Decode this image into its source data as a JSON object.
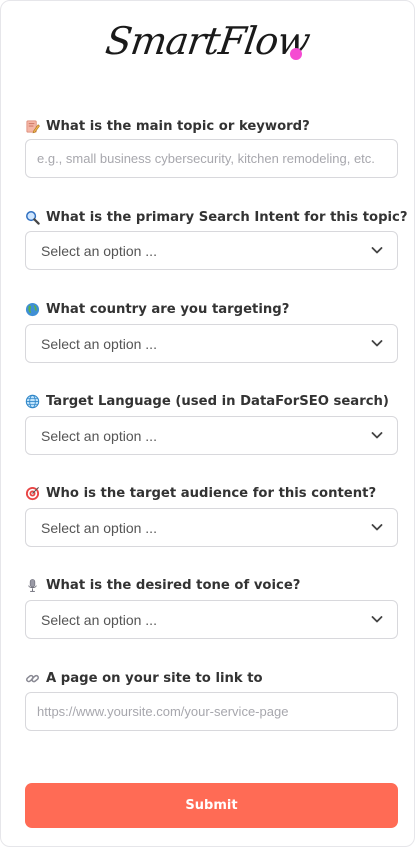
{
  "brand": {
    "logo_text": "SmartFlow",
    "dot_color": "#f54bd2"
  },
  "colors": {
    "submit_bg": "#ff6b55",
    "submit_text": "#ffffff"
  },
  "fields": [
    {
      "icon": "pencil-note-icon",
      "label": "What is the main topic or keyword?",
      "type": "text",
      "placeholder": "e.g., small business cybersecurity, kitchen remodeling, etc.",
      "value": ""
    },
    {
      "icon": "magnifier-icon",
      "label": "What is the primary Search Intent for this topic?",
      "type": "select",
      "value": "Select an option ..."
    },
    {
      "icon": "globe-icon",
      "label": "What country are you targeting?",
      "type": "select",
      "value": "Select an option ..."
    },
    {
      "icon": "globe-meridians-icon",
      "label": "Target Language (used in DataForSEO search)",
      "type": "select",
      "value": "Select an option ..."
    },
    {
      "icon": "target-icon",
      "label": "Who is the target audience for this content?",
      "type": "select",
      "value": "Select an option ..."
    },
    {
      "icon": "microphone-icon",
      "label": "What is the desired tone of voice?",
      "type": "select",
      "value": "Select an option ..."
    },
    {
      "icon": "link-icon",
      "label": "A page on your site to link to",
      "type": "text",
      "placeholder": "https://www.yoursite.com/your-service-page",
      "value": ""
    }
  ],
  "submit_label": "Submit"
}
